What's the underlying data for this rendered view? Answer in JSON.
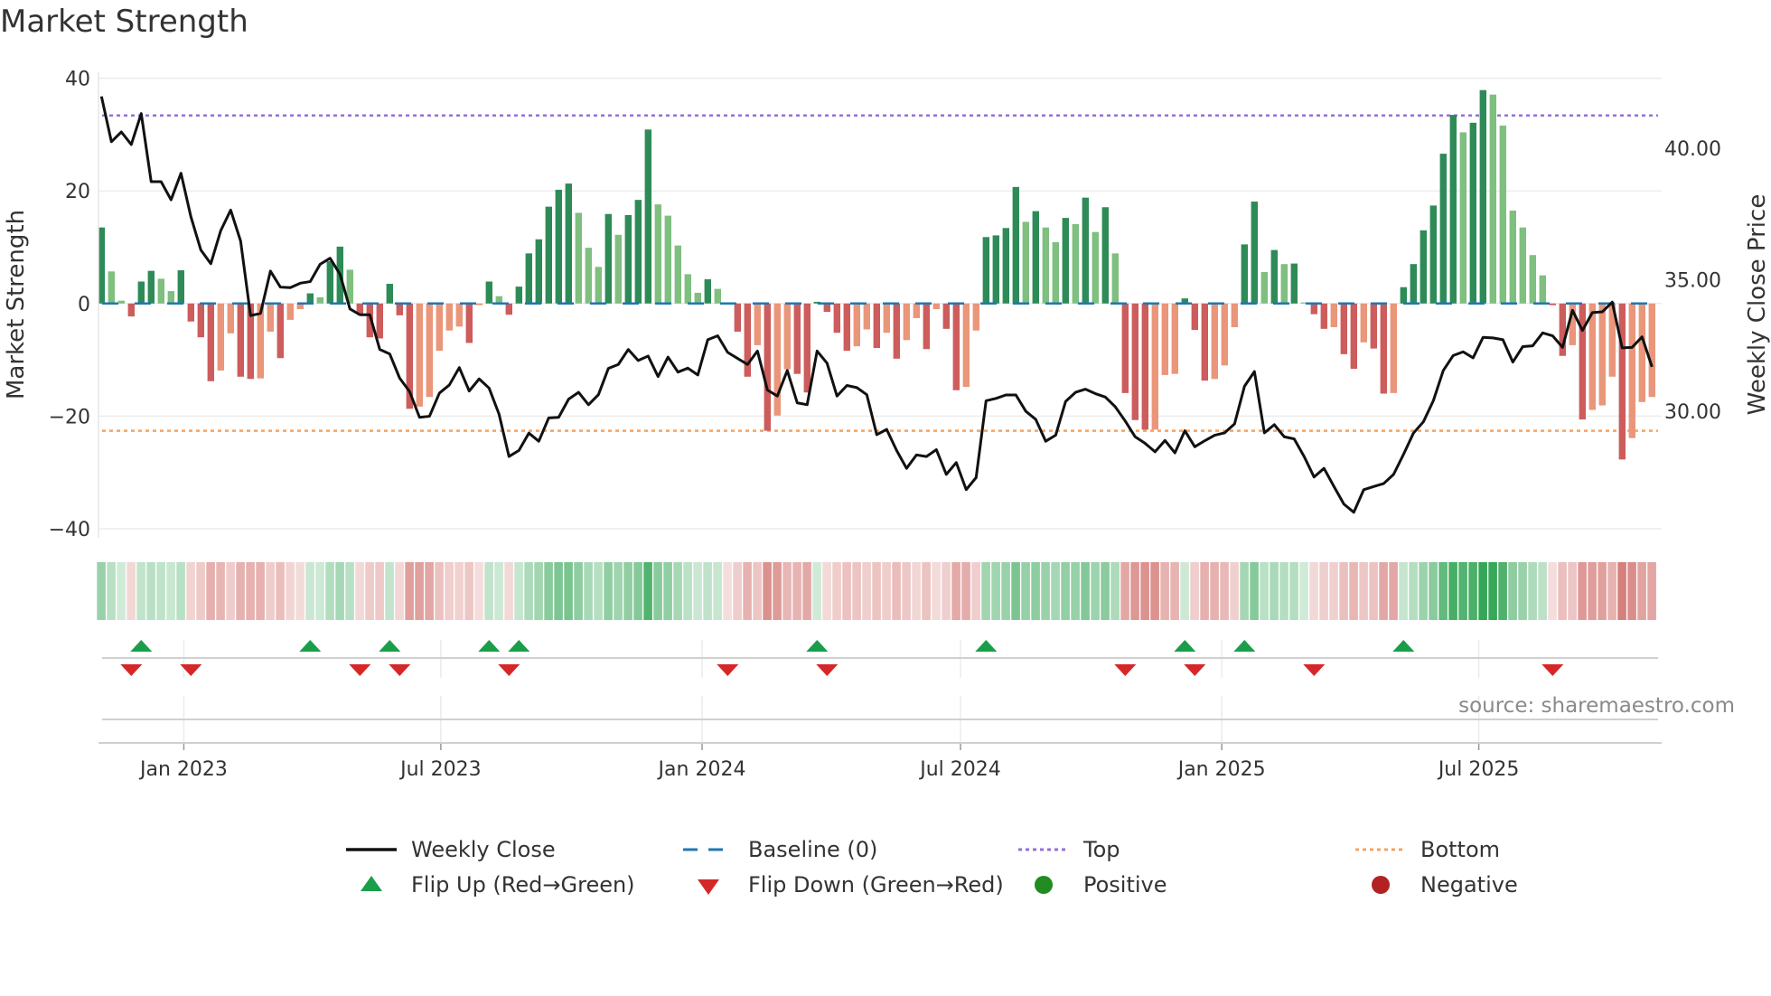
{
  "title": "Market Strength",
  "source": "source: sharemaestro.com",
  "legend": {
    "weekly_close": "Weekly Close",
    "baseline": "Baseline (0)",
    "top": "Top",
    "bottom": "Bottom",
    "flip_up": "Flip Up (Red→Green)",
    "flip_down": "Flip Down (Green→Red)",
    "positive": "Positive",
    "negative": "Negative"
  },
  "colors": {
    "pos_dark": "#2e8b57",
    "pos_light": "#7fbf7f",
    "neg_dark": "#cd5c5c",
    "neg_light": "#e9967a",
    "top": "#9370db",
    "bottom": "#f4a460",
    "baseline": "#1f77b4",
    "close": "#111111",
    "flip_up": "#1a9e4a",
    "flip_down": "#d62728",
    "positive": "#228b22",
    "negative": "#b22222"
  },
  "chart_data": {
    "type": "bar",
    "title": "Market Strength",
    "ylabel": "Market Strength",
    "y2label": "Weekly Close Price",
    "ylim": [
      -40,
      40
    ],
    "y2lim": [
      25,
      42
    ],
    "yticks": [
      {
        "v": 40,
        "label": "40"
      },
      {
        "v": 20,
        "label": "20"
      },
      {
        "v": 0,
        "label": "0"
      },
      {
        "v": -20,
        "label": "−20"
      },
      {
        "v": -40,
        "label": "−40"
      }
    ],
    "y2ticks": [
      {
        "v": 40,
        "label": "40.00"
      },
      {
        "v": 35,
        "label": "35.00"
      },
      {
        "v": 30,
        "label": "30.00"
      }
    ],
    "top_level": 33.4,
    "bottom_level": -22.6,
    "start_date": "2022-11-04",
    "frequency": "weekly",
    "xticks": [
      {
        "date": "2023-01-01",
        "label": "Jan 2023"
      },
      {
        "date": "2023-07-01",
        "label": "Jul 2023"
      },
      {
        "date": "2024-01-01",
        "label": "Jan 2024"
      },
      {
        "date": "2024-07-01",
        "label": "Jul 2024"
      },
      {
        "date": "2025-01-01",
        "label": "Jan 2025"
      },
      {
        "date": "2025-07-01",
        "label": "Jul 2025"
      }
    ],
    "strength": [
      13.5,
      5.7,
      0.5,
      -2.3,
      3.9,
      5.8,
      4.4,
      2.2,
      5.9,
      -3.2,
      -6,
      -13.8,
      -11.9,
      -5.3,
      -13,
      -13.4,
      -13.3,
      -5,
      -9.7,
      -2.9,
      -1,
      1.8,
      1.1,
      7.5,
      10.1,
      6.0,
      -1.8,
      -6,
      -6.2,
      3.5,
      -2.1,
      -18.7,
      -18.3,
      -16.6,
      -8.4,
      -4.8,
      -4.1,
      -7,
      -0.3,
      3.9,
      1.3,
      -2,
      3,
      8.9,
      11.4,
      17.2,
      20.2,
      21.3,
      16.1,
      9.9,
      6.5,
      15.9,
      12.2,
      15.7,
      18.4,
      30.9,
      17.6,
      15.6,
      10.3,
      5.2,
      1.9,
      4.3,
      2.6,
      -0.2,
      -5,
      -13,
      -7.4,
      -22.6,
      -19.9,
      -11.7,
      -12.5,
      -15.8,
      0.3,
      -1.5,
      -5.2,
      -8.4,
      -7.6,
      -4.6,
      -7.9,
      -5.2,
      -9.8,
      -6.5,
      -2.6,
      -8.1,
      -1,
      -4.5,
      -15.4,
      -14.8,
      -4.8,
      11.8,
      12.1,
      13.4,
      20.7,
      14.5,
      16.4,
      13.5,
      10.9,
      15.2,
      14.1,
      18.8,
      12.7,
      17.1,
      8.9,
      -15.9,
      -20.7,
      -22.4,
      -22.4,
      -12.7,
      -12.5,
      0.9,
      -4.7,
      -13.7,
      -13.4,
      -11,
      -4.2,
      10.5,
      18.1,
      5.6,
      9.5,
      7,
      7.1,
      0.2,
      -1.9,
      -4.5,
      -4.2,
      -9,
      -11.6,
      -6.9,
      -8,
      -16,
      -15.9,
      2.9,
      7,
      13,
      17.4,
      26.6,
      33.5,
      30.4,
      32.1,
      37.9,
      37.1,
      31.6,
      16.5,
      13.5,
      8.6,
      5,
      -0.3,
      -9.3,
      -7.4,
      -20.6,
      -18.9,
      -18.1,
      -13,
      -27.7,
      -23.9,
      -17.5,
      -16.6
    ],
    "weekly_close": [
      41.96,
      40.24,
      40.61,
      40.13,
      41.31,
      38.72,
      38.72,
      38.03,
      39.04,
      37.38,
      36.12,
      35.6,
      36.86,
      37.64,
      36.46,
      33.63,
      33.71,
      35.32,
      34.71,
      34.69,
      34.86,
      34.92,
      35.58,
      35.81,
      35.2,
      33.88,
      33.66,
      33.66,
      32.34,
      32.17,
      31.25,
      30.74,
      29.76,
      29.8,
      30.68,
      30.99,
      31.65,
      30.76,
      31.22,
      30.87,
      29.88,
      28.27,
      28.5,
      29.16,
      28.85,
      29.74,
      29.76,
      30.45,
      30.71,
      30.24,
      30.62,
      31.62,
      31.77,
      32.34,
      31.92,
      32.09,
      31.31,
      32.05,
      31.48,
      31.63,
      31.37,
      32.71,
      32.86,
      32.23,
      32.0,
      31.77,
      32.28,
      30.8,
      30.57,
      31.54,
      30.31,
      30.24,
      32.28,
      31.82,
      30.57,
      30.97,
      30.89,
      30.62,
      29.1,
      29.3,
      28.5,
      27.82,
      28.33,
      28.27,
      28.53,
      27.59,
      28.04,
      27.01,
      27.47,
      30.39,
      30.48,
      30.61,
      30.61,
      29.99,
      29.68,
      28.85,
      29.08,
      30.36,
      30.71,
      30.83,
      30.66,
      30.53,
      30.16,
      29.62,
      29.02,
      28.77,
      28.45,
      28.88,
      28.41,
      29.25,
      28.64,
      28.87,
      29.08,
      29.17,
      29.51,
      30.94,
      31.5,
      29.17,
      29.48,
      29.02,
      28.94,
      28.27,
      27.49,
      27.82,
      27.13,
      26.46,
      26.15,
      27.01,
      27.13,
      27.24,
      27.59,
      28.35,
      29.16,
      29.59,
      30.39,
      31.54,
      32.11,
      32.25,
      32.02,
      32.8,
      32.78,
      32.71,
      31.86,
      32.45,
      32.48,
      32.97,
      32.86,
      32.42,
      33.83,
      33.06,
      33.74,
      33.77,
      34.14,
      32.4,
      32.42,
      32.82,
      31.68
    ],
    "grid": true,
    "legend_placement": "bottom"
  }
}
